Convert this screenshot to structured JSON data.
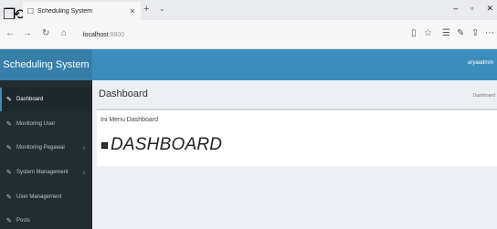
{
  "browser": {
    "tab_title": "Scheduling System",
    "url_host": "localhost",
    "url_port": ":8800"
  },
  "header": {
    "brand": "Scheduling System",
    "user": "aryaadmin"
  },
  "sidebar": {
    "items": [
      {
        "label": "Dashboard"
      },
      {
        "label": "Monitoring User"
      },
      {
        "label": "Monitoring Pegawai"
      },
      {
        "label": "System Management"
      },
      {
        "label": "User Management"
      },
      {
        "label": "Posts"
      }
    ]
  },
  "content": {
    "page_title": "Dashboard",
    "breadcrumb": "Dashboard",
    "box_title": "Ini Menu Dashboard",
    "big_heading": "DASHBOARD"
  },
  "colors": {
    "header": "#3c8dbc",
    "brand": "#367fa9",
    "sidebar": "#222d32",
    "content_bg": "#ecf0f5"
  }
}
